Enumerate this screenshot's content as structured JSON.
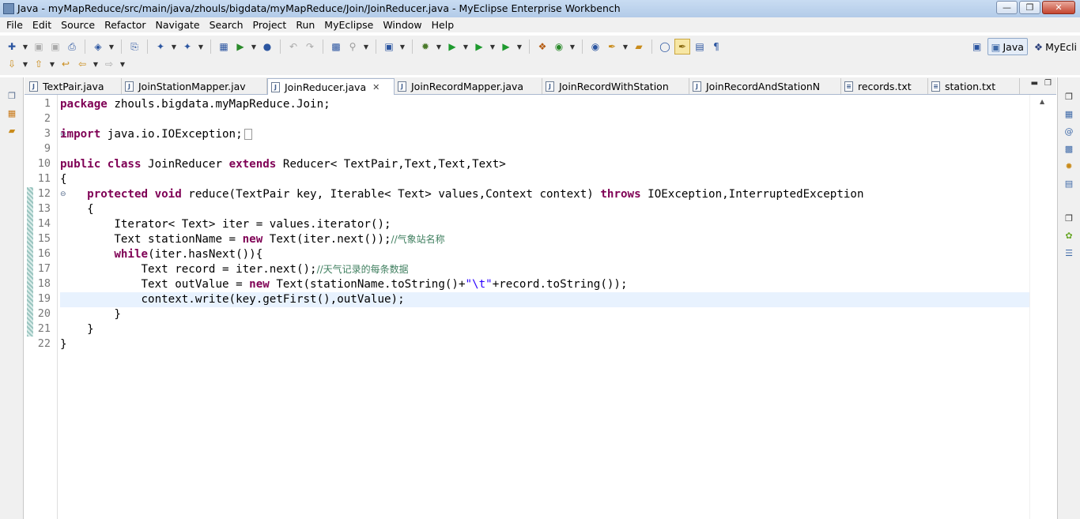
{
  "window": {
    "title": "Java - myMapReduce/src/main/java/zhouls/bigdata/myMapReduce/Join/JoinReducer.java - MyEclipse Enterprise Workbench",
    "buttons": [
      "minimize",
      "maximize",
      "close"
    ]
  },
  "menu": [
    "File",
    "Edit",
    "Source",
    "Refactor",
    "Navigate",
    "Search",
    "Project",
    "Run",
    "MyEclipse",
    "Window",
    "Help"
  ],
  "perspectives": {
    "active": "Java",
    "other": "MyEcli"
  },
  "tabs": [
    {
      "label": "TextPair.java",
      "active": false
    },
    {
      "label": "JoinStationMapper.jav",
      "active": false
    },
    {
      "label": "JoinReducer.java",
      "active": true
    },
    {
      "label": "JoinRecordMapper.java",
      "active": false
    },
    {
      "label": "JoinRecordWithStation",
      "active": false
    },
    {
      "label": "JoinRecordAndStationN",
      "active": false
    },
    {
      "label": "records.txt",
      "active": false
    },
    {
      "label": "station.txt",
      "active": false
    }
  ],
  "editor": {
    "line_numbers": [
      "1",
      "2",
      "3",
      "9",
      "10",
      "11",
      "12",
      "13",
      "14",
      "15",
      "16",
      "17",
      "18",
      "19",
      "20",
      "21",
      "22"
    ],
    "current_line": "19",
    "code": {
      "l1_kw": "package",
      "l1_rest": " zhouls.bigdata.myMapReduce.Join;",
      "l3_kw": "import",
      "l3_rest": " java.io.IOException;",
      "l10_kw1": "public",
      "l10_kw2": "class",
      "l10_name": " JoinReducer ",
      "l10_kw3": "extends",
      "l10_rest": " Reducer< TextPair,Text,Text,Text>",
      "l11": "{",
      "l12_indent": "    ",
      "l12_kw1": "protected",
      "l12_kw2": "void",
      "l12_mid": " reduce(TextPair key, Iterable< Text> values,Context context) ",
      "l12_kw3": "throws",
      "l12_rest": " IOException,InterruptedException",
      "l13": "    {",
      "l14": "        Iterator< Text> iter = values.iterator();",
      "l15_a": "        Text stationName = ",
      "l15_kw": "new",
      "l15_b": " Text(iter.next());",
      "l15_cmt": "//气象站名称",
      "l16_indent": "        ",
      "l16_kw": "while",
      "l16_rest": "(iter.hasNext()){",
      "l17_a": "            Text record = iter.next();",
      "l17_cmt": "//天气记录的每条数据",
      "l18_a": "            Text outValue = ",
      "l18_kw": "new",
      "l18_b": " Text(stationName.toString()+",
      "l18_str": "\"\\t\"",
      "l18_c": "+record.toString());",
      "l19": "            context.write(key.getFirst(),outValue);",
      "l20": "        }",
      "l21": "    }",
      "l22": "}"
    }
  }
}
